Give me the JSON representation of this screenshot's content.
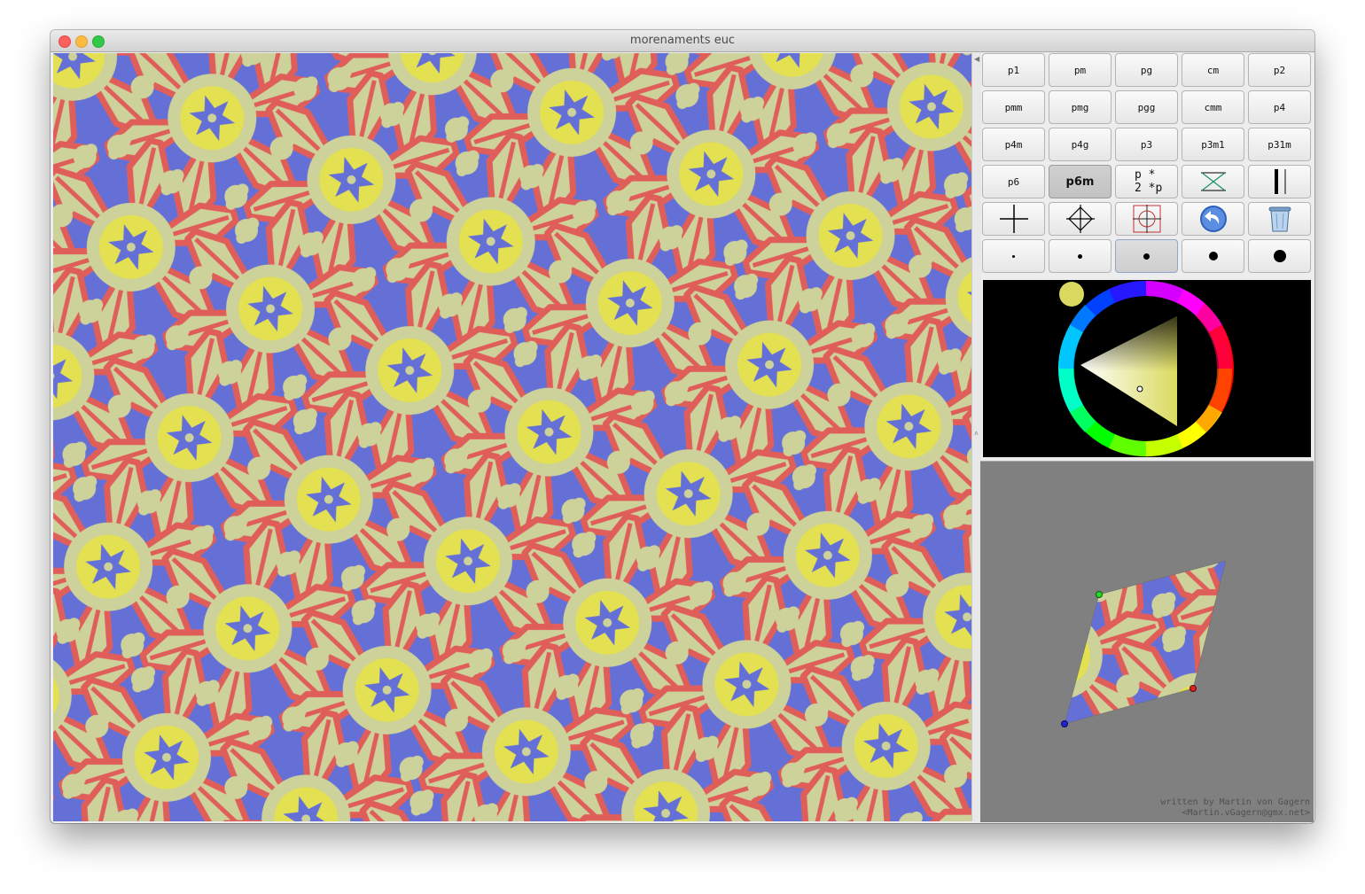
{
  "window": {
    "title": "morenaments euc"
  },
  "palette": {
    "blue": "#6570d6",
    "red": "#e05e5a",
    "yellow": "#e3e052",
    "sage": "#cdd19a",
    "wheel_background": "#000000",
    "preview_background": "#808080",
    "current_color": "#dada60"
  },
  "toolbar": {
    "group_buttons": [
      "p1",
      "pm",
      "pg",
      "cm",
      "p2",
      "pmm",
      "pmg",
      "pgg",
      "cmm",
      "p4",
      "p4m",
      "p4g",
      "p3",
      "p3m1",
      "p31m",
      "p6",
      "p6m"
    ],
    "selected_group": "p6m",
    "orbifold_notation_top": "p *",
    "orbifold_notation_bottom": "2 *p",
    "tool_icons": [
      "mirror-toggle-icon",
      "line-style-icon",
      "crosshair-icon",
      "diamond-cross-icon",
      "target-icon",
      "undo-icon",
      "trash-icon"
    ],
    "brush_sizes": [
      "extra-small",
      "small",
      "medium",
      "large",
      "extra-large"
    ],
    "selected_brush": "medium"
  },
  "credit": {
    "line1": "written by Martin von Gagern",
    "line2": "<Martin.vGagern@gmx.net>"
  }
}
